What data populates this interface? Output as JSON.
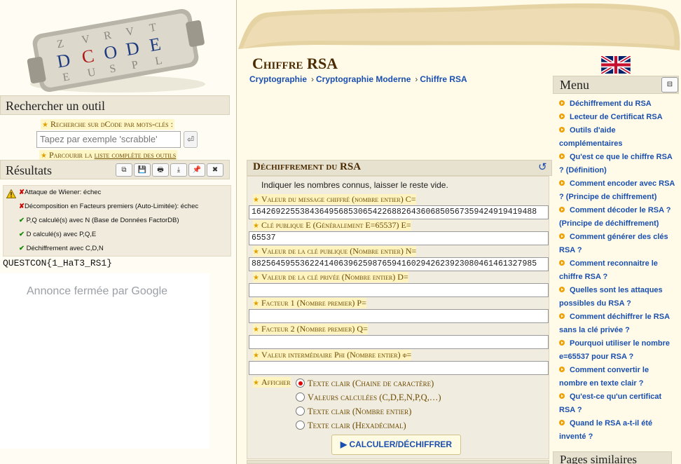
{
  "header": {
    "page_title": "Chiffre RSA",
    "breadcrumb": [
      "Cryptographie",
      "Cryptographie Moderne",
      "Chiffre RSA"
    ]
  },
  "sidebar": {
    "search_title": "Rechercher un outil",
    "search_label": "Recherche sur dCode par mots-clés :",
    "search_placeholder": "Tapez par exemple 'scrabble'",
    "search_go": "⏎",
    "browse_prefix": "Parcourir la ",
    "browse_link": "liste complète des outils",
    "results_title": "Résultats",
    "tool_buttons": [
      "⧉",
      "💾",
      "🖶",
      "⤓",
      "📌",
      "✖"
    ],
    "results": [
      {
        "mark": "✘",
        "text": "Attaque de Wiener: échec"
      },
      {
        "mark": "✘",
        "text": "Décomposition en Facteurs premiers (Auto-Limitée): échec"
      },
      {
        "mark": "✔",
        "text": "P,Q calculé(s) avec N (Base de Données FactorDB)"
      },
      {
        "mark": "✔",
        "text": "D calculé(s) avec P,Q,E"
      },
      {
        "mark": "✔",
        "text": "Déchiffrement avec C,D,N"
      }
    ],
    "flag_output": "QUESTCON{1_HaT3_RS1}",
    "ad_text": "Annonce fermée par Google"
  },
  "main": {
    "section_title": "Déchiffrement du RSA",
    "instructions": "Indiquer les nombres connus, laisser le reste vide.",
    "fields": [
      {
        "label": "Valeur du message chiffré (nombre entier) C=",
        "value": "16426922553843649568530654226882643606850567359424919419488"
      },
      {
        "label": "Clé publique E (Généralement E=65537) E=",
        "value": "65537"
      },
      {
        "label": "Valeur de la clé publique (Nombre entier) N=",
        "value": "88256459553622414063962598765941602942623923080461461327985"
      },
      {
        "label": "Valeur de la clé privée (Nombre entier) D=",
        "value": ""
      },
      {
        "label": "Facteur 1 (Nombre premier) P=",
        "value": ""
      },
      {
        "label": "Facteur 2 (Nombre premier) Q=",
        "value": ""
      },
      {
        "label": "Valeur intermédiaire Phi (Nombre entier) φ=",
        "value": ""
      }
    ],
    "display_label": "Afficher",
    "display_options": [
      {
        "label": "Texte clair (Chaine de caractère)",
        "selected": true
      },
      {
        "label": "Valeurs calculées (C,D,E,N,P,Q,…)",
        "selected": false
      },
      {
        "label": "Texte clair (Nombre entier)",
        "selected": false
      },
      {
        "label": "Texte clair (Hexadécimal)",
        "selected": false
      }
    ],
    "calc_button": "▶ CALCULER/DÉCHIFFRER"
  },
  "menu": {
    "title": "Menu",
    "toggle": "⊟",
    "items": [
      "Déchiffrement du RSA",
      "Lecteur de Certificat RSA",
      "Outils d'aide complémentaires",
      "Qu'est ce que le chiffre RSA ? (Définition)",
      "Comment encoder avec RSA ? (Principe de chiffrement)",
      "Comment décoder le RSA ? (Principe de déchiffrement)",
      "Comment générer des clés RSA ?",
      "Comment reconnaitre le chiffre RSA ?",
      "Quelles sont les attaques possibles du RSA ?",
      "Comment déchiffrer le RSA sans la clé privée ?",
      "Pourquoi utiliser le nombre e=65537 pour RSA ?",
      "Comment convertir le nombre en texte clair ?",
      "Qu'est-ce qu'un certificat RSA ?",
      "Quand le RSA a-t-il été inventé ?"
    ],
    "similar_title": "Pages similaires"
  }
}
